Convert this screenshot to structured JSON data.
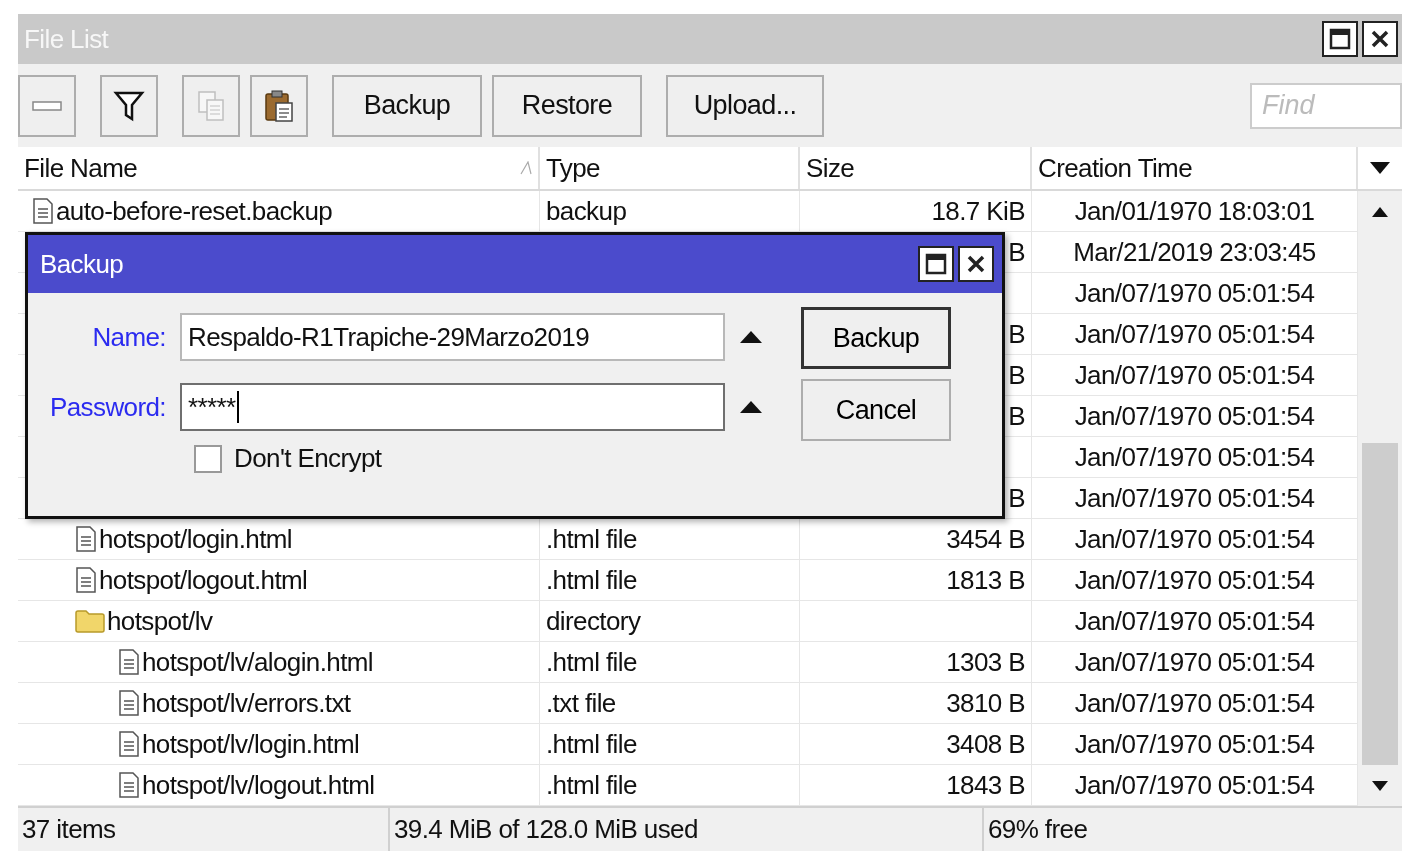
{
  "window": {
    "title": "File List"
  },
  "toolbar": {
    "icon_buttons": [
      {
        "disabled": false
      },
      {
        "disabled": false
      },
      {
        "disabled": true
      },
      {
        "disabled": false
      }
    ],
    "buttons": [
      "Backup",
      "Restore",
      "Upload..."
    ],
    "search": {
      "placeholder": "Find"
    }
  },
  "table": {
    "columns": [
      {
        "label": "File Name",
        "sorted": true
      },
      {
        "label": "Type",
        "sorted": false
      },
      {
        "label": "Size",
        "sorted": false
      },
      {
        "label": "Creation Time",
        "sorted": false
      }
    ],
    "rows": [
      {
        "kind": "file",
        "name": "auto-before-reset.backup",
        "type": "backup",
        "size": "18.7 KiB",
        "time": "Jan/01/1970 18:03:01"
      },
      {
        "size": "B",
        "time": "Mar/21/2019 23:03:45"
      },
      {
        "time": "Jan/07/1970 05:01:54",
        "children": [
          {
            "size": "B",
            "time": "Jan/07/1970 05:01:54"
          },
          {
            "size": "B",
            "time": "Jan/07/1970 05:01:54"
          },
          {
            "size": "B",
            "time": "Jan/07/1970 05:01:54"
          },
          {
            "time": "Jan/07/1970 05:01:54",
            "children": [
              {
                "size": "B",
                "time": "Jan/07/1970 05:01:54"
              }
            ]
          },
          {
            "kind": "file",
            "name": "hotspot/login.html",
            "type": ".html file",
            "size": "3454 B",
            "time": "Jan/07/1970 05:01:54"
          },
          {
            "kind": "file",
            "name": "hotspot/logout.html",
            "type": ".html file",
            "size": "1813 B",
            "time": "Jan/07/1970 05:01:54"
          },
          {
            "kind": "folder",
            "name": "hotspot/lv",
            "type": "directory",
            "time": "Jan/07/1970 05:01:54",
            "children": [
              {
                "kind": "file",
                "name": "hotspot/lv/alogin.html",
                "type": ".html file",
                "size": "1303 B",
                "time": "Jan/07/1970 05:01:54"
              },
              {
                "kind": "file",
                "name": "hotspot/lv/errors.txt",
                "type": ".txt file",
                "size": "3810 B",
                "time": "Jan/07/1970 05:01:54"
              },
              {
                "kind": "file",
                "name": "hotspot/lv/login.html",
                "type": ".html file",
                "size": "3408 B",
                "time": "Jan/07/1970 05:01:54"
              },
              {
                "kind": "file",
                "name": "hotspot/lv/logout.html",
                "type": ".html file",
                "size": "1843 B",
                "time": "Jan/07/1970 05:01:54"
              }
            ]
          }
        ]
      }
    ]
  },
  "status_bar": [
    "37 items",
    "39.4 MiB of 128.0 MiB used",
    "69% free"
  ],
  "dialog": {
    "title": "Backup",
    "fields": [
      {
        "label": "Name:",
        "value": "Respaldo-R1Trapiche-29Marzo2019",
        "focused": false
      },
      {
        "label": "Password:",
        "value": "*****",
        "focused": true
      }
    ],
    "checkbox": {
      "label": "Don't Encrypt",
      "checked": false
    },
    "buttons": [
      {
        "label": "Backup",
        "default": true
      },
      {
        "label": "Cancel",
        "default": false
      }
    ]
  }
}
